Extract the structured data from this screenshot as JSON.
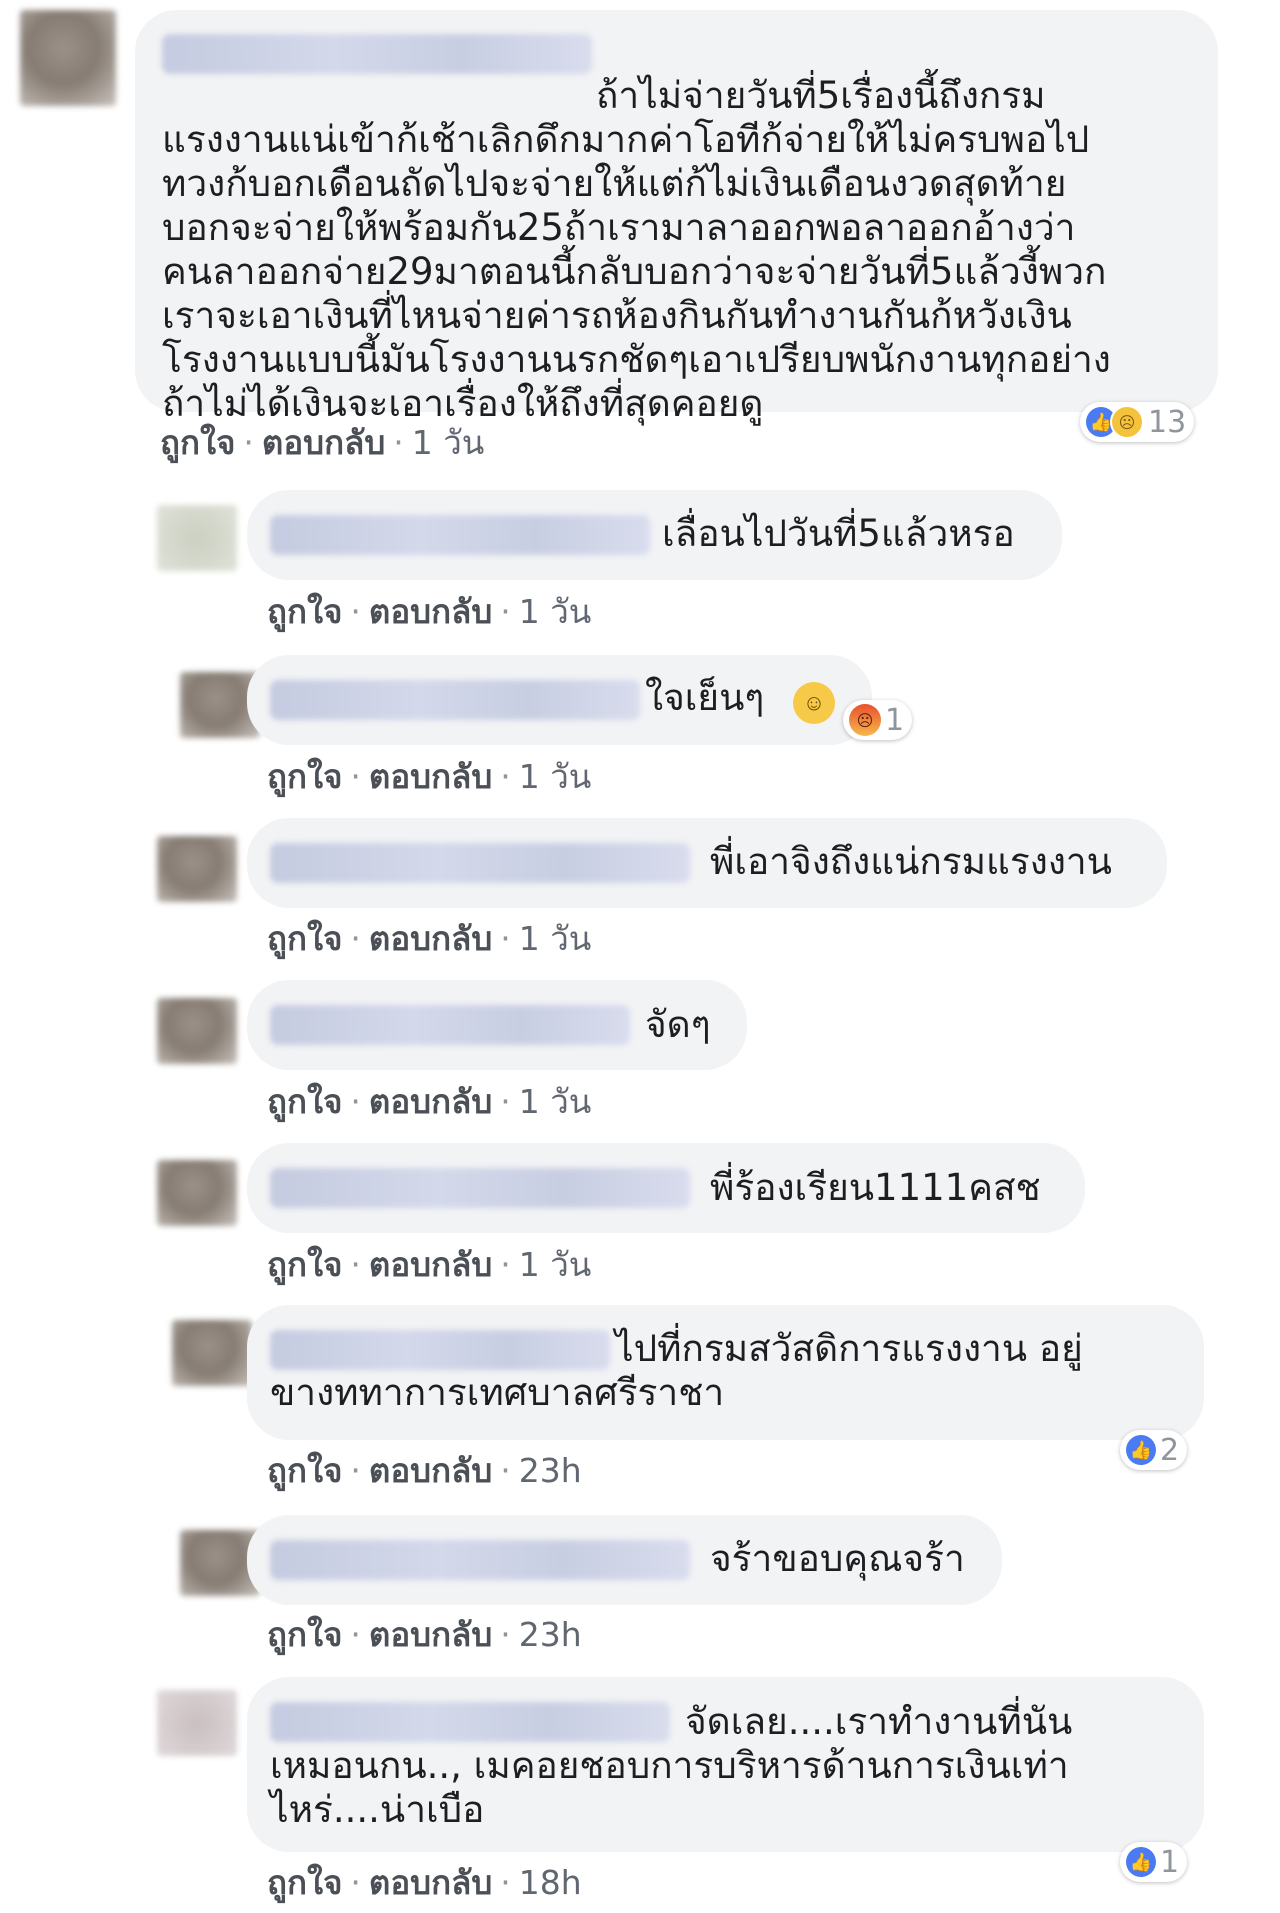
{
  "actions": {
    "like": "ถูกใจ",
    "reply": "ตอบกลับ",
    "sep": "·"
  },
  "comments": [
    {
      "lines": [
        "ถ้าไม่จ่ายวันที่5เรื่องนี้ถึงกรม",
        "แรงงานแน่เข้าก้เช้าเลิกดึกมากค่าโอทีก้จ่ายให้ไม่ครบพอไป",
        "ทวงก้บอกเดือนถัดไปจะจ่ายให้แต่ก้ไม่เงินเดือนงวดสุดท้าย",
        "บอกจะจ่ายให้พร้อมกัน25ถ้าเรามาลาออกพอลาออกอ้างว่า",
        "คนลาออกจ่าย29มาตอนนี้กลับบอกว่าจะจ่ายวันที่5แล้วงี้พวก",
        "เราจะเอาเงินที่ไหนจ่ายค่ารถห้องกินกันทำงานกันก้หวังเงิน",
        "โรงงานแบบนี้มันโรงงานนรกชัดๆเอาเปรียบพนักงานทุกอย่าง",
        "ถ้าไม่ได้เงินจะเอาเรื่องให้ถึงที่สุดคอยดู"
      ],
      "time": "1 วัน",
      "reaction_count": "13"
    },
    {
      "lines": [
        "เลื่อนไปวันที่5แล้วหรอ"
      ],
      "time": "1 วัน"
    },
    {
      "lines": [
        "ใจเย็นๆ"
      ],
      "time": "1 วัน",
      "reaction_count": "1"
    },
    {
      "lines": [
        "พี่เอาจิงถึงแน่กรมแรงงาน"
      ],
      "time": "1 วัน"
    },
    {
      "lines": [
        "จัดๆ"
      ],
      "time": "1 วัน"
    },
    {
      "lines": [
        "พี่ร้องเรียน1111คสช"
      ],
      "time": "1 วัน"
    },
    {
      "lines": [
        "ไปที่กรมสวัสดิการแรงงาน อยู่",
        "ขางททาการเทศบาลศรีราชา"
      ],
      "time": "23h",
      "reaction_count": "2"
    },
    {
      "lines": [
        "จร้าขอบคุณจร้า"
      ],
      "time": "23h"
    },
    {
      "lines": [
        "จัดเลย....เราทำงานที่นัน",
        "เหมอนกน.., เมคอยชอบการบริหารด้านการเงินเท่า",
        "ไหร่....น่าเบือ"
      ],
      "time": "18h",
      "reaction_count": "1"
    }
  ],
  "icons": {
    "like": "like-reaction-icon",
    "sad": "sad-reaction-icon",
    "angry": "angry-reaction-icon",
    "laugh": "laughing-emoji-icon"
  },
  "colors": {
    "bubble": "#f2f3f5",
    "link": "#4b4f56",
    "meta": "#90949c",
    "like_blue": "#4a7bf2"
  }
}
